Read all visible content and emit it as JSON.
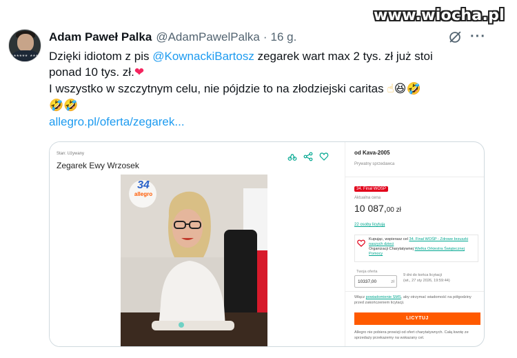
{
  "watermark": "www.wiocha.pl",
  "tweet": {
    "author_name": "Adam Paweł Palka",
    "handle": "@AdamPawelPalka",
    "separator": "·",
    "time": "16 g.",
    "avatar_caption": "****** ***",
    "line1_start": "Dzięki idiotom z pis ",
    "mention": "@KownackiBartosz",
    "line1_end": " zegarek wart max 2 tys. zł już stoi",
    "line2": "ponad 10 tys. zł.",
    "line3": "I wszystko w szczytnym celu, nie pójdzie to na złodziejski caritas",
    "link": "allegro.pl/oferta/zegarek..."
  },
  "icons": {
    "grok": "grok-icon",
    "more": "more-icon",
    "heart": "heart-emoji",
    "pointer": "pointing-up-emoji",
    "grin": "grinning-squinting-emoji",
    "rofl": "rolling-on-floor-laughing-emoji"
  },
  "emoji": {
    "heart": "❤",
    "pointer": "☝",
    "grin": "😆",
    "rofl": "🤣"
  },
  "card": {
    "breadcrumb": "Stan: Używany",
    "product_title": "Zegarek Ewy Wrzosek",
    "photo_logo_number": "34",
    "photo_logo_sub": "allegro",
    "seller_name": "od Kava-2005",
    "seller_type": "Prywatny sprzedawca",
    "wosp_badge": "34. Finał WOŚP",
    "price_label": "Aktualna cena",
    "price_main": "10 087,",
    "price_cents": "00 zł",
    "bids_link": "22 osoby licytują",
    "charity_prefix": "Kupując, wspierasz cel ",
    "charity_goal": "34. Finał WOŚP - Zdrowe brzuszki naszych dzieci",
    "charity_org_prefix": "Organizacji Charytatywnej ",
    "charity_org": "Wielka Orkiestra Świątecznej Pomocy",
    "offer_label": "Twoja oferta",
    "offer_value": "10337,00",
    "offer_currency": "zł",
    "offer_info_1": "9 dni do końca licytacji",
    "offer_info_2": "(wt., 27 sty 2026, 19:59:44)",
    "notify_prefix": "Włącz ",
    "notify_link": "powiadomienie SMS",
    "notify_suffix": ", aby otrzymać wiadomość na półgodziny przed zakończeniem licytacji.",
    "bid_button": "LICYTUJ",
    "footnote": "Allegro nie pobiera prowizji od ofert charytatywnych. Całą kwotę ze sprzedaży przekazemy na wskazany cel."
  },
  "colors": {
    "link_blue": "#1d9bf0",
    "allegro_orange": "#ff5a00",
    "allegro_green": "#00a790",
    "wosp_red": "#e2001a"
  }
}
